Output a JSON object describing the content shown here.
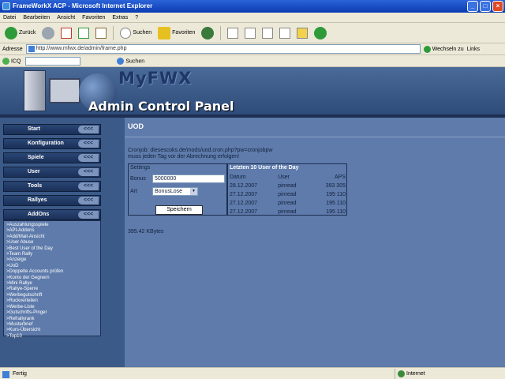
{
  "window": {
    "title": "FrameWorkX ACP - Microsoft Internet Explorer",
    "minimize": "_",
    "maximize": "□",
    "close": "×"
  },
  "menu": [
    "Datei",
    "Bearbeiten",
    "Ansicht",
    "Favoriten",
    "Extras",
    "?"
  ],
  "toolbar": {
    "back": "Zurück",
    "search": "Suchen",
    "favorites": "Favoriten"
  },
  "address": {
    "label": "Adresse",
    "url": "http://www.mfwx.de/admin/frame.php",
    "go": "Wechseln zu",
    "links": "Links"
  },
  "links_bar": {
    "icq": "ICQ",
    "search": "Suchen"
  },
  "banner": {
    "brand": "MyFWX",
    "subtitle": "Admin Control Panel"
  },
  "nav": [
    {
      "label": "Start",
      "arrow": "<<<"
    },
    {
      "label": "Konfiguration",
      "arrow": "<<<"
    },
    {
      "label": "Spiele",
      "arrow": "<<<"
    },
    {
      "label": "User",
      "arrow": "<<<"
    },
    {
      "label": "Tools",
      "arrow": "<<<"
    },
    {
      "label": "Rallyes",
      "arrow": "<<<"
    },
    {
      "label": "AddOns",
      "arrow": "<<<"
    }
  ],
  "addons": [
    ">Auszahlungsspiele",
    ">API-Addons",
    ">Add/Mail-Ansicht",
    ">User Abuse",
    ">Best User of the Day",
    ">Team Rally",
    ">Anzeige",
    ">UoD",
    ">Doppelte Accounts prüfen",
    ">Konto der Gegnern",
    ">Mini Rallye",
    ">Rallye-Sperre",
    ">Werbegutschrift",
    ">Ruckverteilen",
    ">Werbe-Liste",
    ">Gutschrifts-Pinger",
    ">Refrallyrank",
    ">Musterbrief",
    ">Kurs-Übersicht",
    ">Top10"
  ],
  "content": {
    "title": "UOD",
    "note_line1": "Cronjob: diesescoks.de/mods/uod.cron.php?pw=cronjobpw",
    "note_line2": "muss jeden Tag vor der Abrechnung erfolgen!",
    "settings": {
      "header": "Settings",
      "bonus_label": "Bonus",
      "bonus_value": "5000000",
      "art_label": "Art",
      "art_value": "BonusLose",
      "save": "Speichern"
    },
    "stats": {
      "header": "Letzten 10 User of the Day",
      "columns": [
        "Datum",
        "User",
        "APS"
      ],
      "rows": [
        [
          "28.12.2007",
          "pinread",
          "393 305"
        ],
        [
          "27.12.2007",
          "pinread",
          "195 110"
        ],
        [
          "27.12.2007",
          "pinread",
          "195 110"
        ],
        [
          "27.12.2007",
          "pinread",
          "195 110"
        ]
      ]
    },
    "size": "395.42 KBytes"
  },
  "status": {
    "left": "Fertig",
    "zone": "Internet"
  },
  "colors": {
    "page_bg": "#3c5a88",
    "panel_bg": "#5e7bab",
    "nav_bg": "#1a3058",
    "title_bar": "#0a3bb2"
  }
}
